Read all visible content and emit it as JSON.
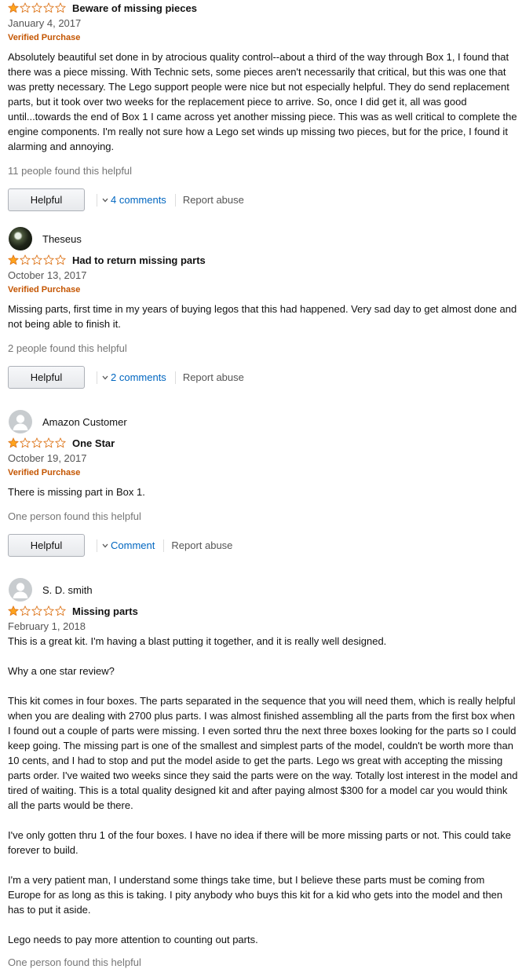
{
  "reviews": [
    {
      "rating": 1,
      "title": "Beware of missing pieces",
      "date": "January 4, 2017",
      "verified": "Verified Purchase",
      "body": [
        "Absolutely beautiful set done in by atrocious quality control--about a third of the way through Box 1, I found that there was a piece missing. With Technic sets, some pieces aren't necessarily that critical, but this was one that was pretty necessary. The Lego support people were nice but not especially helpful. They do send replacement parts, but it took over two weeks for the replacement piece to arrive. So, once I did get it, all was good until...towards the end of Box 1 I came across yet another missing piece. This was as well critical to complete the engine components. I'm really not sure how a Lego set winds up missing two pieces, but for the price, I found it alarming and annoying."
      ],
      "helpful_count": "11 people found this helpful",
      "helpful_button": "Helpful",
      "comments": "4 comments",
      "report": "Report abuse"
    },
    {
      "profile_name": "Theseus",
      "avatar": "photo",
      "rating": 1,
      "title": "Had to return missing parts",
      "date": "October 13, 2017",
      "verified": "Verified Purchase",
      "body": [
        "Missing parts, first time in my years of buying legos that this had happened. Very sad day to get almost done and not being able to finish it."
      ],
      "helpful_count": "2 people found this helpful",
      "helpful_button": "Helpful",
      "comments": "2 comments",
      "report": "Report abuse"
    },
    {
      "profile_name": "Amazon Customer",
      "avatar": "default",
      "rating": 1,
      "title": "One Star",
      "date": "October 19, 2017",
      "verified": "Verified Purchase",
      "body": [
        "There is missing part in Box 1."
      ],
      "helpful_count": "One person found this helpful",
      "helpful_button": "Helpful",
      "comments": "Comment",
      "report": "Report abuse"
    },
    {
      "profile_name": "S. D. smith",
      "avatar": "default",
      "rating": 1,
      "title": "Missing parts",
      "date": "February 1, 2018",
      "body": [
        "This is a great kit. I'm having a blast putting it together, and it is really well designed.",
        "Why a one star review?",
        "This kit comes in four boxes. The parts separated in the sequence that you will need them, which is really helpful when you are dealing with 2700 plus parts. I was almost finished assembling all the parts from the first box when I found out a couple of parts were missing. I even sorted thru the next three boxes looking for the parts so I could keep going. The missing part is one of the smallest and simplest parts of the model, couldn't be worth more than 10 cents, and I had to stop and put the model aside to get the parts. Lego ws great with accepting the missing parts order. I've waited two weeks since they said the parts were on the way. Totally lost interest in the model and tired of waiting. This is a total quality designed kit and after paying almost $300 for a model car you would think all the parts would be there.",
        "I've only gotten thru 1 of the four boxes. I have no idea if there will be more missing parts or not. This could take forever to build.",
        "I'm a very patient man, I understand some things take time, but I believe these parts must be coming from Europe for as long as this is taking. I pity anybody who buys this kit for a kid who gets into the model and then has to put it aside.",
        "Lego needs to pay more attention to counting out parts."
      ],
      "helpful_count": "One person found this helpful"
    }
  ],
  "colors": {
    "star_fill": "#ffa41c",
    "star_outline": "#de7921",
    "verified": "#c45500",
    "link": "#0066c0",
    "muted": "#767676"
  }
}
